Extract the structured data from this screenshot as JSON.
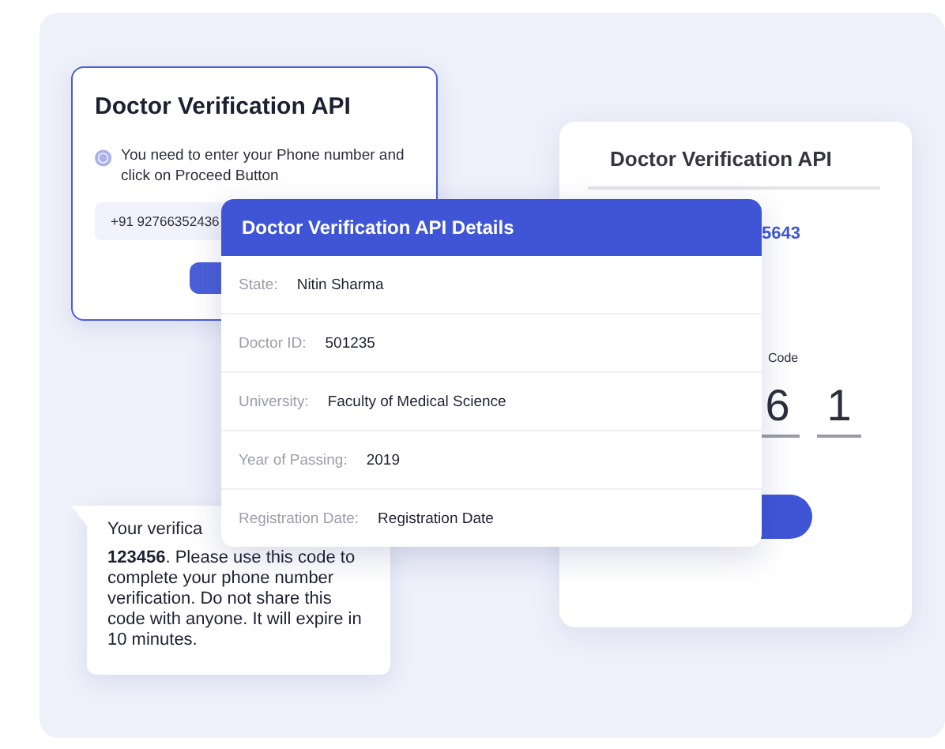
{
  "phone_card": {
    "title": "Doctor Verification API",
    "hint": "You need to enter your Phone number and click on Proceed Button",
    "phone": "+91 92766352436"
  },
  "otp_card": {
    "title": "Doctor Verification API",
    "number_fragment": "5643",
    "code_label": "Code",
    "digits": [
      "6",
      "1"
    ]
  },
  "details_card": {
    "title": "Doctor Verification API Details",
    "rows": [
      {
        "label": "State:",
        "value": "Nitin Sharma"
      },
      {
        "label": "Doctor ID:",
        "value": "501235"
      },
      {
        "label": "University:",
        "value": "Faculty of Medical Science"
      },
      {
        "label": "Year of Passing:",
        "value": "2019"
      },
      {
        "label": "Registration Date:",
        "value": "Registration Date"
      }
    ]
  },
  "sms": {
    "first_line": "Your verifica",
    "body": "**123456**. Please use this code to complete your phone number verification. Do not share this code with anyone. It will expire in 10 minutes."
  }
}
